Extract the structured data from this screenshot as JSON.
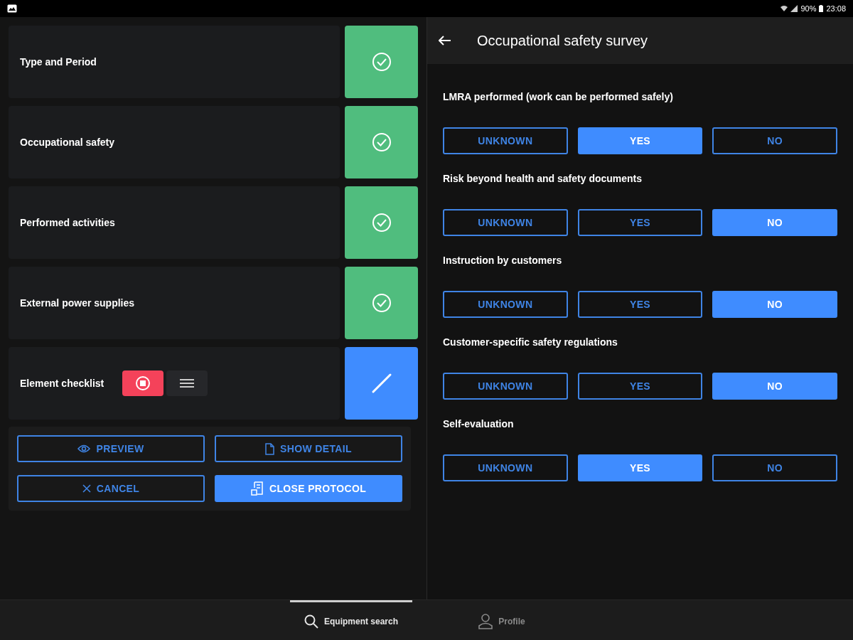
{
  "status_bar": {
    "battery": "90%",
    "time": "23:08"
  },
  "steps": [
    {
      "label": "Type and Period",
      "kind": "done"
    },
    {
      "label": "Occupational safety",
      "kind": "done"
    },
    {
      "label": "Performed activities",
      "kind": "done"
    },
    {
      "label": "External power supplies",
      "kind": "done"
    },
    {
      "label": "Element checklist",
      "kind": "edit",
      "modes": [
        {
          "kind": "record",
          "selected": true
        },
        {
          "kind": "list",
          "selected": false
        }
      ]
    }
  ],
  "actions": [
    {
      "label": "PREVIEW",
      "kind": "outline"
    },
    {
      "label": "SHOW DETAIL",
      "kind": "outline"
    },
    {
      "label": "CANCEL",
      "kind": "outline"
    },
    {
      "label": "CLOSE PROTOCOL",
      "kind": "primary"
    }
  ],
  "survey": {
    "title": "Occupational safety survey",
    "questions": [
      {
        "label": "LMRA performed (work can be performed safely)",
        "options": [
          {
            "label": "UNKNOWN",
            "selected": false
          },
          {
            "label": "YES",
            "selected": true
          },
          {
            "label": "NO",
            "selected": false
          }
        ]
      },
      {
        "label": "Risk beyond health and safety documents",
        "options": [
          {
            "label": "UNKNOWN",
            "selected": false
          },
          {
            "label": "YES",
            "selected": false
          },
          {
            "label": "NO",
            "selected": true
          }
        ]
      },
      {
        "label": "Instruction by customers",
        "options": [
          {
            "label": "UNKNOWN",
            "selected": false
          },
          {
            "label": "YES",
            "selected": false
          },
          {
            "label": "NO",
            "selected": true
          }
        ]
      },
      {
        "label": "Customer-specific safety regulations",
        "options": [
          {
            "label": "UNKNOWN",
            "selected": false
          },
          {
            "label": "YES",
            "selected": false
          },
          {
            "label": "NO",
            "selected": true
          }
        ]
      },
      {
        "label": "Self-evaluation",
        "options": [
          {
            "label": "UNKNOWN",
            "selected": false
          },
          {
            "label": "YES",
            "selected": true
          },
          {
            "label": "NO",
            "selected": false
          }
        ]
      }
    ]
  },
  "bottom_nav": [
    {
      "label": "Equipment search",
      "selected": true
    },
    {
      "label": "Profile",
      "selected": false
    }
  ]
}
